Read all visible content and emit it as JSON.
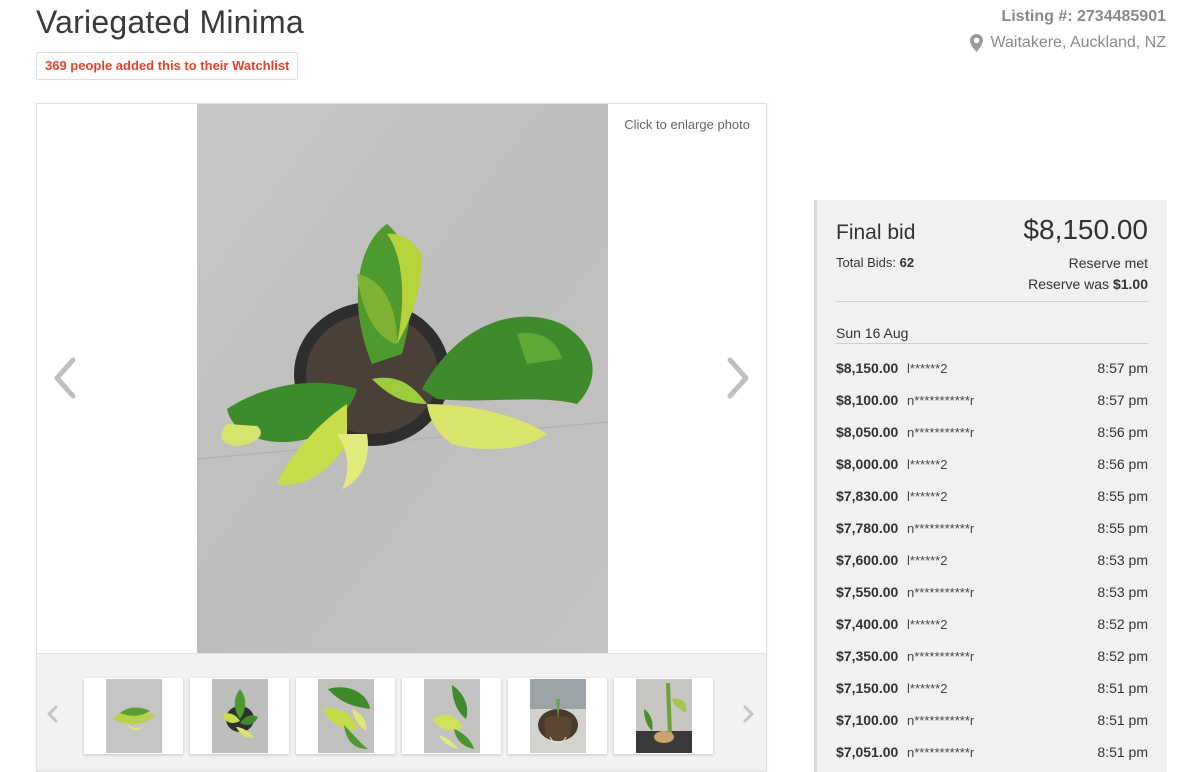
{
  "listing_title": "Variegated Minima",
  "watchlist_text": "369 people added this to their Watchlist",
  "listing_number": "Listing #: 2734485901",
  "location": "Waitakere, Auckland, NZ",
  "gallery": {
    "enlarge_text": "Click to enlarge photo",
    "thumbnail_count": 6
  },
  "bid_panel": {
    "final_label": "Final bid",
    "final_amount": "$8,150.00",
    "total_bids_label": "Total Bids:",
    "total_bids_value": "62",
    "reserve_met": "Reserve met",
    "reserve_was_label": "Reserve was",
    "reserve_was_value": "$1.00",
    "date_heading": "Sun 16 Aug",
    "bids": [
      {
        "amount": "$8,150.00",
        "user": "l******2",
        "time": "8:57 pm"
      },
      {
        "amount": "$8,100.00",
        "user": "n***********r",
        "time": "8:57 pm"
      },
      {
        "amount": "$8,050.00",
        "user": "n***********r",
        "time": "8:56 pm"
      },
      {
        "amount": "$8,000.00",
        "user": "l******2",
        "time": "8:56 pm"
      },
      {
        "amount": "$7,830.00",
        "user": "l******2",
        "time": "8:55 pm"
      },
      {
        "amount": "$7,780.00",
        "user": "n***********r",
        "time": "8:55 pm"
      },
      {
        "amount": "$7,600.00",
        "user": "l******2",
        "time": "8:53 pm"
      },
      {
        "amount": "$7,550.00",
        "user": "n***********r",
        "time": "8:53 pm"
      },
      {
        "amount": "$7,400.00",
        "user": "l******2",
        "time": "8:52 pm"
      },
      {
        "amount": "$7,350.00",
        "user": "n***********r",
        "time": "8:52 pm"
      },
      {
        "amount": "$7,150.00",
        "user": "l******2",
        "time": "8:51 pm"
      },
      {
        "amount": "$7,100.00",
        "user": "n***********r",
        "time": "8:51 pm"
      },
      {
        "amount": "$7,051.00",
        "user": "n***********r",
        "time": "8:51 pm"
      }
    ]
  },
  "colors": {
    "watchlist_red": "#e0452b",
    "muted_gray": "#8a8a8a",
    "panel_bg": "#f1f1f1"
  },
  "icons": {
    "location": "map-pin-icon",
    "prev": "chevron-left-icon",
    "next": "chevron-right-icon"
  }
}
